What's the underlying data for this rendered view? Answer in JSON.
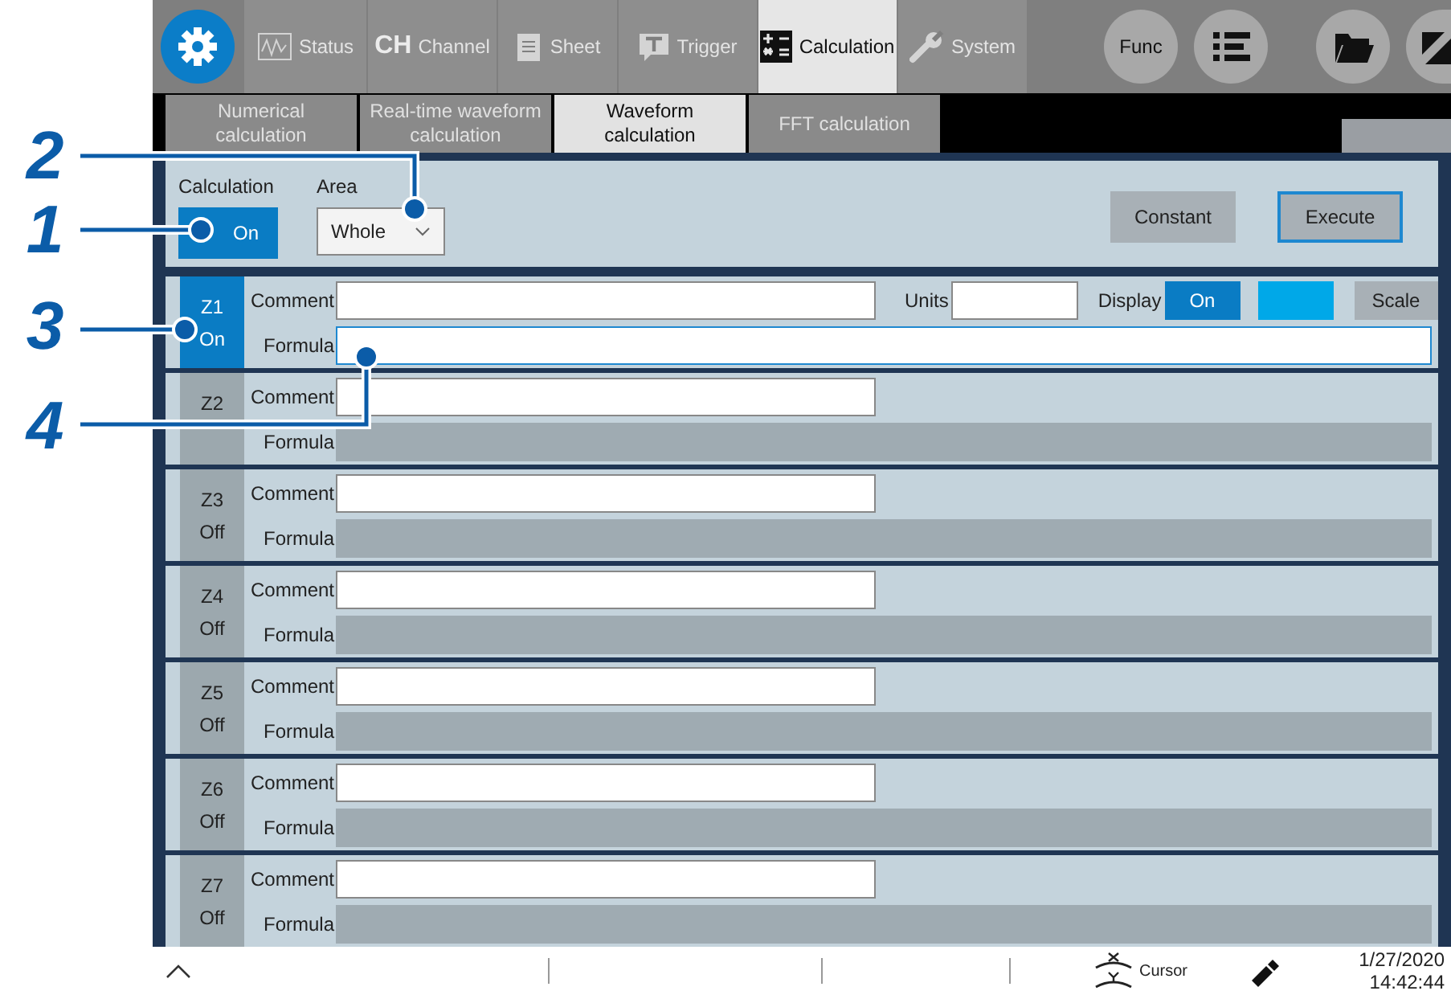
{
  "top_tabs": [
    {
      "label": "Status",
      "selected": false
    },
    {
      "label": "Channel",
      "icon_text": "CH",
      "selected": false
    },
    {
      "label": "Sheet",
      "selected": false
    },
    {
      "label": "Trigger",
      "selected": false
    },
    {
      "label": "Calculation",
      "selected": true
    },
    {
      "label": "System",
      "selected": false
    }
  ],
  "func_button": "Func",
  "sub_tabs": [
    {
      "label": "Numerical calculation",
      "selected": false
    },
    {
      "label": "Real-time waveform calculation",
      "selected": false
    },
    {
      "label": "Waveform calculation",
      "selected": true
    },
    {
      "label": "FFT calculation",
      "selected": false
    }
  ],
  "calculation": {
    "label": "Calculation",
    "value": "On",
    "on": true
  },
  "area": {
    "label": "Area",
    "value": "Whole"
  },
  "buttons": [
    "Constant",
    "Execute"
  ],
  "channels": [
    {
      "name": "Z1",
      "on": true,
      "state": "On",
      "comment_label": "Comment",
      "formula_label": "Formula",
      "units_label": "Units",
      "display_label": "Display",
      "display_value": "On",
      "color": "#00a8e8",
      "scale": "Scale"
    },
    {
      "name": "Z2",
      "on": false,
      "comment_label": "Comment",
      "formula_label": "Formula"
    },
    {
      "name": "Z3",
      "on": false,
      "state": "Off",
      "comment_label": "Comment",
      "formula_label": "Formula"
    },
    {
      "name": "Z4",
      "on": false,
      "state": "Off",
      "comment_label": "Comment",
      "formula_label": "Formula"
    },
    {
      "name": "Z5",
      "on": false,
      "state": "Off",
      "comment_label": "Comment",
      "formula_label": "Formula"
    },
    {
      "name": "Z6",
      "on": false,
      "state": "Off",
      "comment_label": "Comment",
      "formula_label": "Formula"
    },
    {
      "name": "Z7",
      "on": false,
      "state": "Off",
      "comment_label": "Comment",
      "formula_label": "Formula"
    }
  ],
  "status_bar": {
    "cursor": "Cursor",
    "date": "1/27/2020",
    "time": "14:42:44"
  },
  "callouts": [
    {
      "number": "2"
    },
    {
      "number": "1"
    },
    {
      "number": "3"
    },
    {
      "number": "4"
    }
  ]
}
